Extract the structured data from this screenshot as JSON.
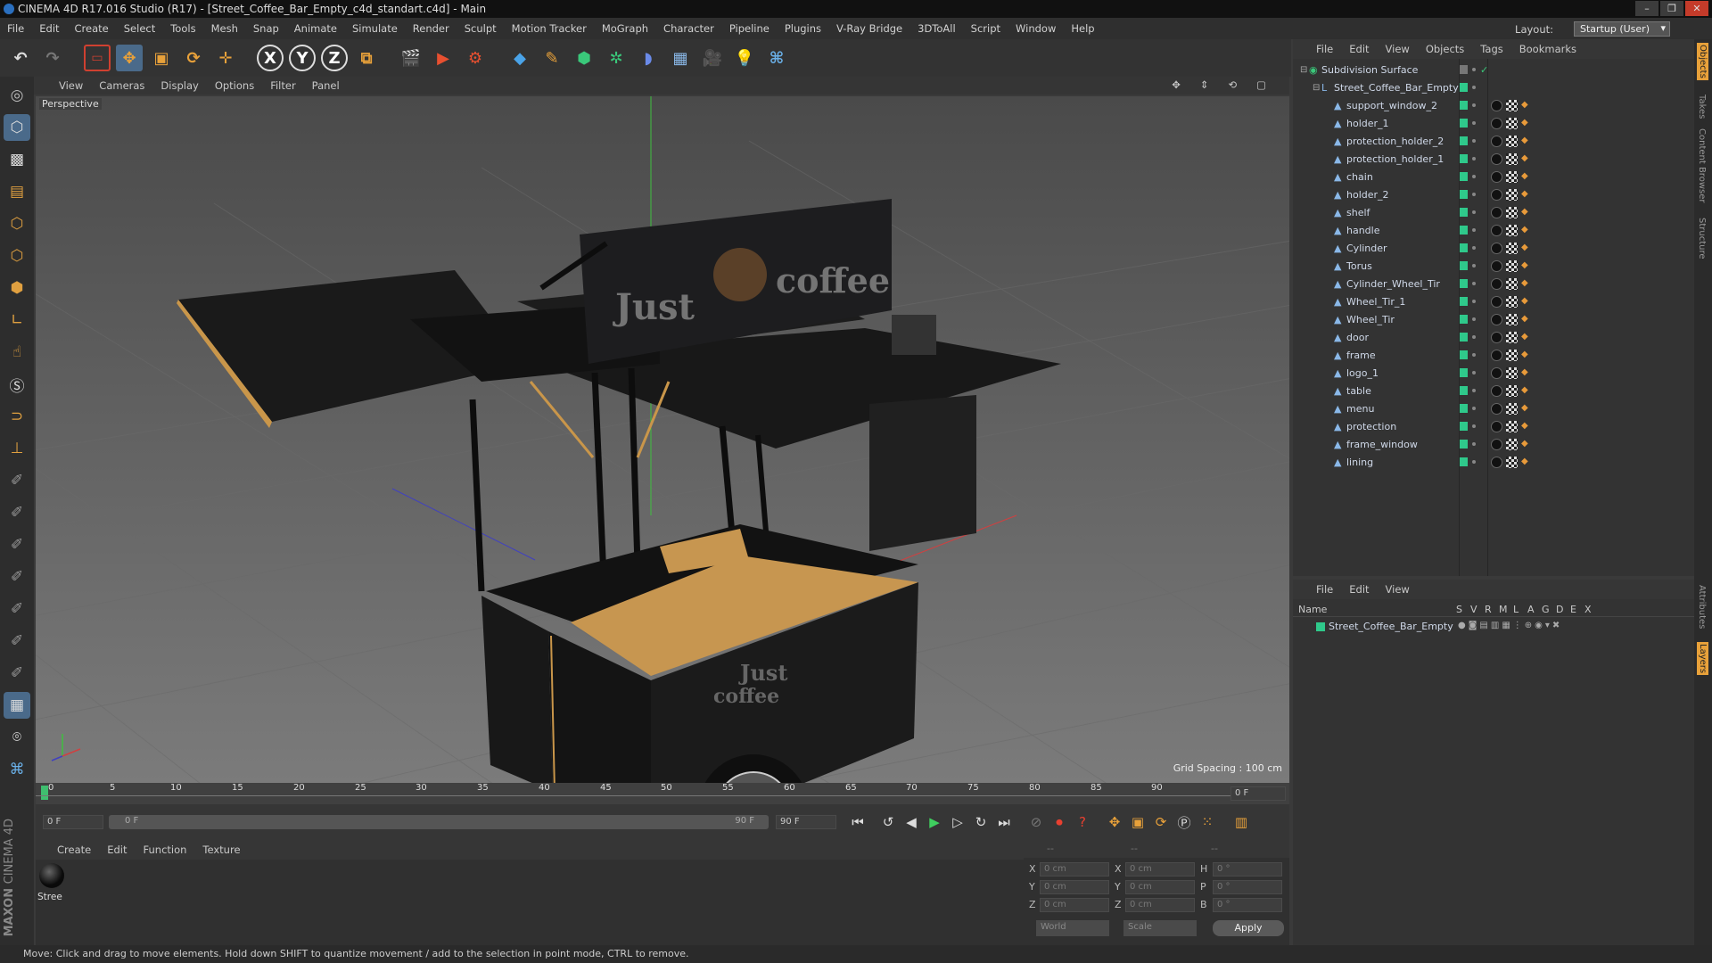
{
  "window": {
    "title": "CINEMA 4D R17.016 Studio (R17) - [Street_Coffee_Bar_Empty_c4d_standart.c4d] - Main"
  },
  "menubar": {
    "items": [
      "File",
      "Edit",
      "Create",
      "Select",
      "Tools",
      "Mesh",
      "Snap",
      "Animate",
      "Simulate",
      "Render",
      "Sculpt",
      "Motion Tracker",
      "MoGraph",
      "Character",
      "Pipeline",
      "Plugins",
      "V-Ray Bridge",
      "3DToAll",
      "Script",
      "Window",
      "Help"
    ]
  },
  "layout": {
    "label": "Layout:",
    "value": "Startup (User)"
  },
  "viewport": {
    "menu": [
      "View",
      "Cameras",
      "Display",
      "Options",
      "Filter",
      "Panel"
    ],
    "label": "Perspective",
    "grid_spacing": "Grid Spacing : 100 cm",
    "sign_text_1": "Just",
    "sign_text_2": "coffee",
    "sign_text_3": "Just",
    "sign_text_4": "coffee"
  },
  "timeline": {
    "ticks": [
      "0",
      "5",
      "10",
      "15",
      "20",
      "25",
      "30",
      "35",
      "40",
      "45",
      "50",
      "55",
      "60",
      "65",
      "70",
      "75",
      "80",
      "85",
      "90"
    ],
    "end_field": "0 F"
  },
  "playbar": {
    "start": "0 F",
    "range_start": "0 F",
    "range_end": "90 F",
    "end": "90 F"
  },
  "material": {
    "menu": [
      "Create",
      "Edit",
      "Function",
      "Texture"
    ],
    "item_label": "Stree"
  },
  "coords": {
    "headers": [
      "--",
      "--",
      "--"
    ],
    "rows": [
      {
        "a": "X",
        "av": "0 cm",
        "b": "X",
        "bv": "0 cm",
        "c": "H",
        "cv": "0 °"
      },
      {
        "a": "Y",
        "av": "0 cm",
        "b": "Y",
        "bv": "0 cm",
        "c": "P",
        "cv": "0 °"
      },
      {
        "a": "Z",
        "av": "0 cm",
        "b": "Z",
        "bv": "0 cm",
        "c": "B",
        "cv": "0 °"
      }
    ],
    "world": "World",
    "scale": "Scale",
    "apply": "Apply"
  },
  "objects": {
    "menu": [
      "File",
      "Edit",
      "View",
      "Objects",
      "Tags",
      "Bookmarks"
    ],
    "root": "Subdivision Surface",
    "group": "Street_Coffee_Bar_Empty",
    "children": [
      "support_window_2",
      "holder_1",
      "protection_holder_2",
      "protection_holder_1",
      "chain",
      "holder_2",
      "shelf",
      "handle",
      "Cylinder",
      "Torus",
      "Cylinder_Wheel_Tir",
      "Wheel_Tir_1",
      "Wheel_Tir",
      "door",
      "frame",
      "logo_1",
      "table",
      "menu",
      "protection",
      "frame_window",
      "lining"
    ]
  },
  "layers": {
    "menu": [
      "File",
      "Edit",
      "View"
    ],
    "columns": [
      "Name",
      "S",
      "V",
      "R",
      "M",
      "L",
      "A",
      "G",
      "D",
      "E",
      "X"
    ],
    "row": "Street_Coffee_Bar_Empty"
  },
  "right_tabs": [
    "Objects",
    "Takes",
    "Content Browser",
    "Structure",
    "Attributes",
    "Layers"
  ],
  "status": "Move: Click and drag to move elements. Hold down SHIFT to quantize movement / add to the selection in point mode, CTRL to remove.",
  "brand": {
    "maxon": "MAXON",
    "c4d": "CINEMA 4D"
  },
  "colors": {
    "accent": "#2fc98b",
    "orange": "#e8a13a"
  }
}
